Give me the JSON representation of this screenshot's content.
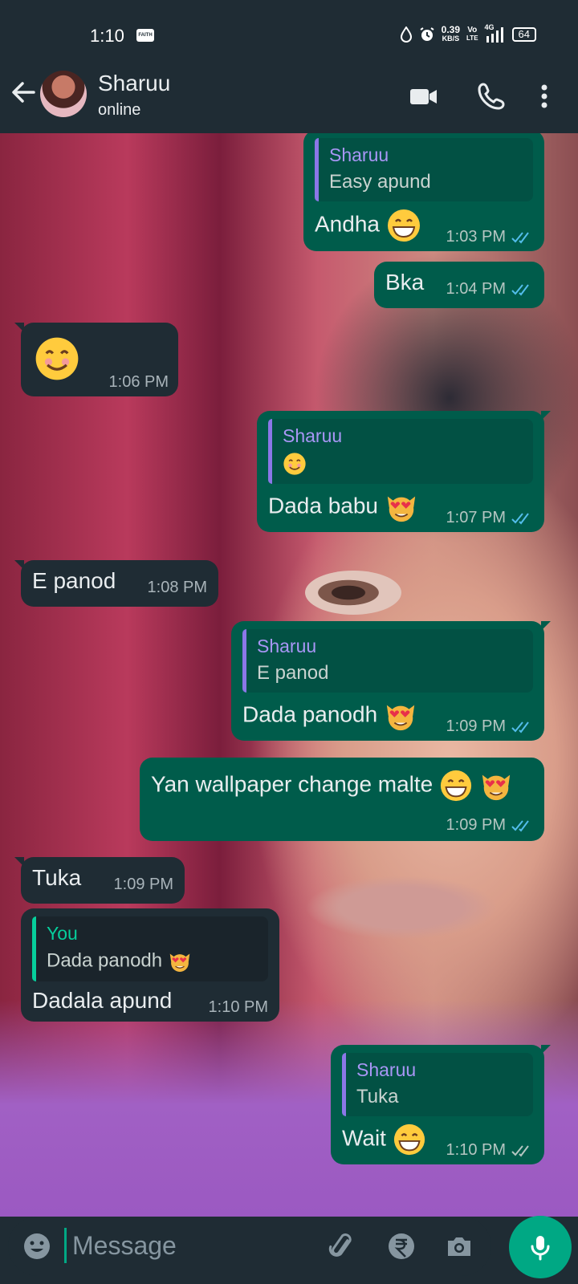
{
  "status_bar": {
    "time": "1:10",
    "notif_label": "FAITH",
    "speed_value": "0.39",
    "speed_unit": "KB/S",
    "volte_top": "Vo",
    "volte_bottom": "LTE",
    "network": "4G",
    "battery": "64"
  },
  "header": {
    "contact_name": "Sharuu",
    "contact_status": "online"
  },
  "messages": [
    {
      "dir": "out",
      "quote_author": "Sharuu",
      "quote_text": "Easy apund",
      "text": "Andha",
      "time": "1:03 PM"
    },
    {
      "dir": "out",
      "text": "Bka",
      "time": "1:04 PM"
    },
    {
      "dir": "in",
      "text": "",
      "time": "1:06 PM"
    },
    {
      "dir": "out",
      "quote_author": "Sharuu",
      "quote_text": "",
      "text": "Dada babu",
      "time": "1:07 PM"
    },
    {
      "dir": "in",
      "text": "E panod",
      "time": "1:08 PM"
    },
    {
      "dir": "out",
      "quote_author": "Sharuu",
      "quote_text": "E panod",
      "text": "Dada panodh",
      "time": "1:09 PM"
    },
    {
      "dir": "out",
      "text": "Yan wallpaper change malte",
      "time": "1:09 PM"
    },
    {
      "dir": "in",
      "text": "Tuka",
      "time": "1:09 PM"
    },
    {
      "dir": "in",
      "quote_author": "You",
      "quote_text": "Dada panodh",
      "text": "Dadala apund",
      "time": "1:10 PM"
    },
    {
      "dir": "out",
      "quote_author": "Sharuu",
      "quote_text": "Tuka",
      "text": "Wait",
      "time": "1:10 PM"
    }
  ],
  "input": {
    "placeholder": "Message"
  },
  "colors": {
    "bar_bg": "#1f2c34",
    "outgoing_bubble": "#005c4b",
    "incoming_bubble": "#1f2c34",
    "accent": "#00a884",
    "read_ticks": "#53bdeb",
    "quote_author_sharuu": "#a896f5",
    "quote_author_you": "#06cf9c"
  },
  "icons": {
    "back": "arrow-left-icon",
    "video": "video-call-icon",
    "call": "phone-icon",
    "menu": "more-vert-icon",
    "emoji": "emoji-icon",
    "attach": "paperclip-icon",
    "payment": "rupee-icon",
    "camera": "camera-icon",
    "mic": "mic-icon"
  }
}
